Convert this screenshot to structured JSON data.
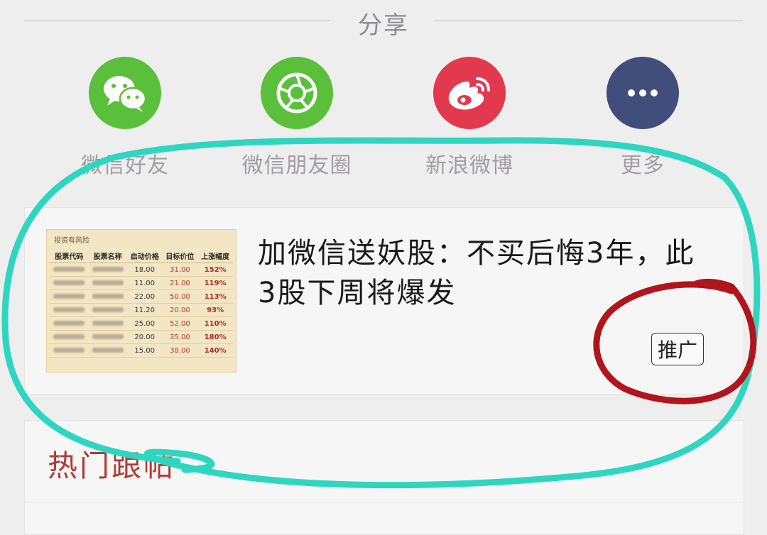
{
  "share": {
    "title": "分享",
    "items": [
      {
        "label": "微信好友",
        "icon": "wechat-icon",
        "color": "#5ac03b"
      },
      {
        "label": "微信朋友圈",
        "icon": "moments-icon",
        "color": "#5ac03b"
      },
      {
        "label": "新浪微博",
        "icon": "weibo-icon",
        "color": "#e2394f"
      },
      {
        "label": "更多",
        "icon": "more-icon",
        "color": "#414d7a"
      }
    ]
  },
  "ad": {
    "title": "加微信送妖股：不买后悔3年，此3股下周将爆发",
    "badge": "推广",
    "thumbnail": {
      "caption": "投资有风险",
      "headers": [
        "股票代码",
        "股票名称",
        "启动价格",
        "目标价位",
        "上涨幅度"
      ],
      "rows": [
        {
          "start": "18.00",
          "target": "31.00",
          "rise": "152%"
        },
        {
          "start": "11.00",
          "target": "21.00",
          "rise": "119%"
        },
        {
          "start": "22.00",
          "target": "50.00",
          "rise": "113%"
        },
        {
          "start": "11.20",
          "target": "20.00",
          "rise": "93%"
        },
        {
          "start": "25.00",
          "target": "52.00",
          "rise": "110%"
        },
        {
          "start": "20.00",
          "target": "35.00",
          "rise": "180%"
        },
        {
          "start": "15.00",
          "target": "38.00",
          "rise": "140%"
        }
      ]
    }
  },
  "hot": {
    "title": "热门跟帖"
  },
  "colors": {
    "annotation_teal": "#2ed6c0",
    "annotation_red": "#b1141a"
  }
}
